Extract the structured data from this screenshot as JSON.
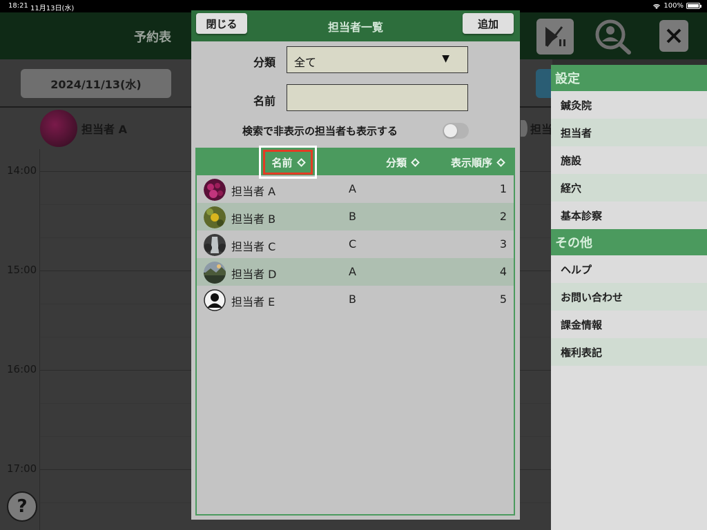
{
  "status_bar": {
    "time": "18:21",
    "date": "11月13日(水)",
    "battery": "100%"
  },
  "background_app": {
    "title": "予約表",
    "date_button": "2024/11/13(水)",
    "staff_left": "担当者 A",
    "staff_right": "担当",
    "hours": [
      "14:00",
      "15:00",
      "16:00",
      "17:00"
    ],
    "help_label": "?"
  },
  "header_icons": [
    "play-pause-icon",
    "user-search-icon",
    "close-icon"
  ],
  "modal": {
    "title": "担当者一覧",
    "close_label": "閉じる",
    "add_label": "追加",
    "category_label": "分類",
    "category_value": "全て",
    "name_label": "名前",
    "name_value": "",
    "toggle_label": "検索で非表示の担当者も表示する",
    "toggle_on": false,
    "columns": {
      "name": "名前",
      "category": "分類",
      "order": "表示順序"
    },
    "rows": [
      {
        "name": "担当者 A",
        "category": "A",
        "order": "1"
      },
      {
        "name": "担当者 B",
        "category": "B",
        "order": "2"
      },
      {
        "name": "担当者 C",
        "category": "C",
        "order": "3"
      },
      {
        "name": "担当者 D",
        "category": "A",
        "order": "4"
      },
      {
        "name": "担当者 E",
        "category": "B",
        "order": "5"
      }
    ]
  },
  "menu": {
    "settings_header": "設定",
    "settings_items": [
      "鍼灸院",
      "担当者",
      "施設",
      "経穴",
      "基本診察"
    ],
    "other_header": "その他",
    "other_items": [
      "ヘルプ",
      "お問い合わせ",
      "課金情報",
      "権利表記"
    ]
  },
  "colors": {
    "brand_green": "#4b9a5e",
    "header_green": "#2d6e3c",
    "highlight_red": "#e43b24"
  }
}
